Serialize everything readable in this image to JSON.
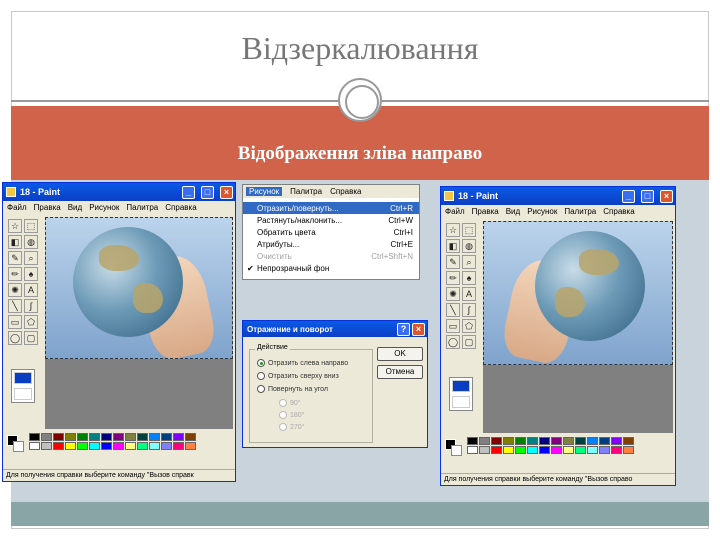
{
  "slide": {
    "title": "Відзеркалювання",
    "subtitle": "Відображення зліва направо"
  },
  "paint_left": {
    "title": "18 - Paint",
    "menu": [
      "Файл",
      "Правка",
      "Вид",
      "Рисунок",
      "Палитра",
      "Справка"
    ],
    "status": "Для получения справки выберите команду \"Вызов справк"
  },
  "paint_right": {
    "title": "18 - Paint",
    "menu": [
      "Файл",
      "Правка",
      "Вид",
      "Рисунок",
      "Палитра",
      "Справка"
    ],
    "status": "Для получения справки выберите команду \"Вызов справо"
  },
  "image_menu": {
    "bar": [
      "Рисунок",
      "Палитра",
      "Справка"
    ],
    "items": [
      {
        "label": "Отразить/повернуть...",
        "shortcut": "Ctrl+R",
        "highlight": true,
        "disabled": false,
        "checked": false
      },
      {
        "label": "Растянуть/наклонить...",
        "shortcut": "Ctrl+W",
        "highlight": false,
        "disabled": false,
        "checked": false
      },
      {
        "label": "Обратить цвета",
        "shortcut": "Ctrl+I",
        "highlight": false,
        "disabled": false,
        "checked": false
      },
      {
        "label": "Атрибуты...",
        "shortcut": "Ctrl+E",
        "highlight": false,
        "disabled": false,
        "checked": false
      },
      {
        "label": "Очистить",
        "shortcut": "Ctrl+Shft+N",
        "highlight": false,
        "disabled": true,
        "checked": false
      },
      {
        "label": "Непрозрачный фон",
        "shortcut": "",
        "highlight": false,
        "disabled": false,
        "checked": true
      }
    ]
  },
  "flip_dialog": {
    "title": "Отражение и поворот",
    "group_label": "Действие",
    "options": [
      {
        "label": "Отразить слева направо",
        "selected": true,
        "disabled": false
      },
      {
        "label": "Отразить сверху вниз",
        "selected": false,
        "disabled": false
      },
      {
        "label": "Повернуть на угол",
        "selected": false,
        "disabled": false
      },
      {
        "label": "90°",
        "selected": false,
        "disabled": true
      },
      {
        "label": "180°",
        "selected": false,
        "disabled": true
      },
      {
        "label": "270°",
        "selected": false,
        "disabled": true
      }
    ],
    "ok_label": "OK",
    "cancel_label": "Отмена"
  },
  "icons": {
    "tools": [
      "free-select-icon",
      "select-icon",
      "eraser-icon",
      "fill-icon",
      "color-picker-icon",
      "magnifier-icon",
      "pencil-icon",
      "brush-icon",
      "airbrush-icon",
      "text-icon",
      "line-icon",
      "curve-icon",
      "rectangle-icon",
      "polygon-icon",
      "ellipse-icon",
      "rounded-rect-icon"
    ],
    "tool_glyphs": [
      "☆",
      "⬚",
      "◧",
      "◍",
      "✎",
      "⌕",
      "✏",
      "♠",
      "✺",
      "A",
      "╲",
      "∫",
      "▭",
      "⬠",
      "◯",
      "▢"
    ]
  },
  "palette": [
    "#000000",
    "#808080",
    "#800000",
    "#808000",
    "#008000",
    "#008080",
    "#000080",
    "#800080",
    "#808040",
    "#004040",
    "#0080ff",
    "#004080",
    "#8000ff",
    "#804000",
    "#ffffff",
    "#c0c0c0",
    "#ff0000",
    "#ffff00",
    "#00ff00",
    "#00ffff",
    "#0000ff",
    "#ff00ff",
    "#ffff80",
    "#00ff80",
    "#80ffff",
    "#8080ff",
    "#ff0080",
    "#ff8040"
  ]
}
